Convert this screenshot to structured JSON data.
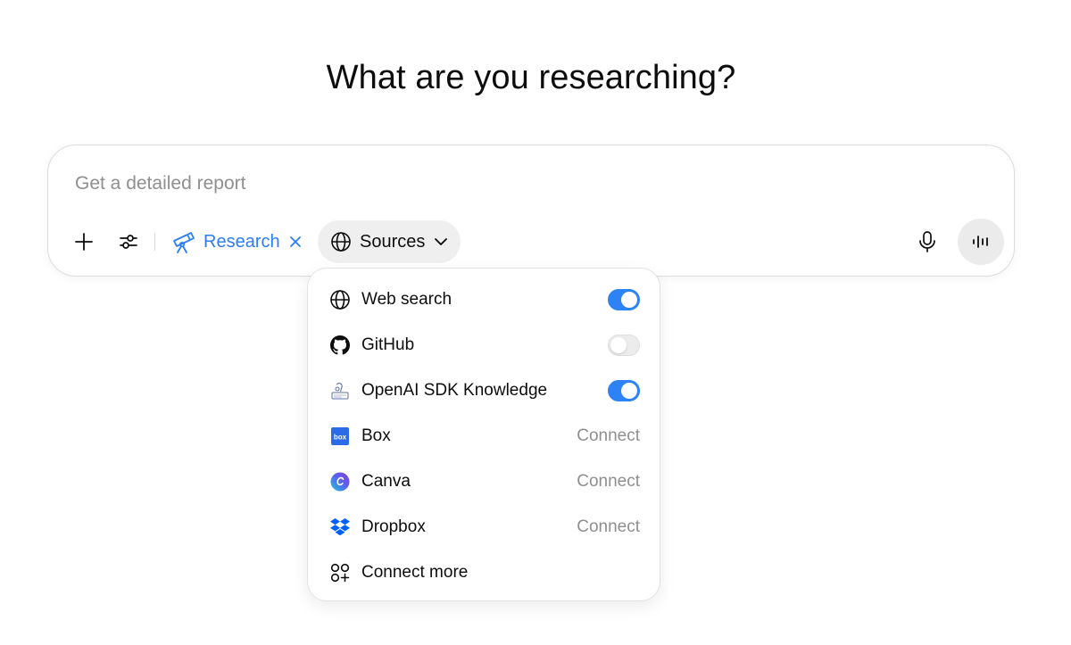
{
  "heading": "What are you researching?",
  "composer": {
    "placeholder": "Get a detailed report",
    "value": "",
    "research_label": "Research",
    "sources_label": "Sources"
  },
  "sources_menu": {
    "items": [
      {
        "label": "Web search",
        "icon": "globe-icon",
        "control": "toggle",
        "enabled": true
      },
      {
        "label": "GitHub",
        "icon": "github-icon",
        "control": "toggle",
        "enabled": false
      },
      {
        "label": "OpenAI SDK Knowledge",
        "icon": "knowledge-icon",
        "control": "toggle",
        "enabled": true
      },
      {
        "label": "Box",
        "icon": "box-icon",
        "control": "connect",
        "action_label": "Connect"
      },
      {
        "label": "Canva",
        "icon": "canva-icon",
        "control": "connect",
        "action_label": "Connect"
      },
      {
        "label": "Dropbox",
        "icon": "dropbox-icon",
        "control": "connect",
        "action_label": "Connect"
      },
      {
        "label": "Connect more",
        "icon": "apps-plus-icon",
        "control": "none"
      }
    ]
  },
  "colors": {
    "accent": "#2a7df5",
    "toggle_on": "#2d82f6",
    "box_brand": "#2b6ae8",
    "dropbox_brand": "#0061fe"
  }
}
